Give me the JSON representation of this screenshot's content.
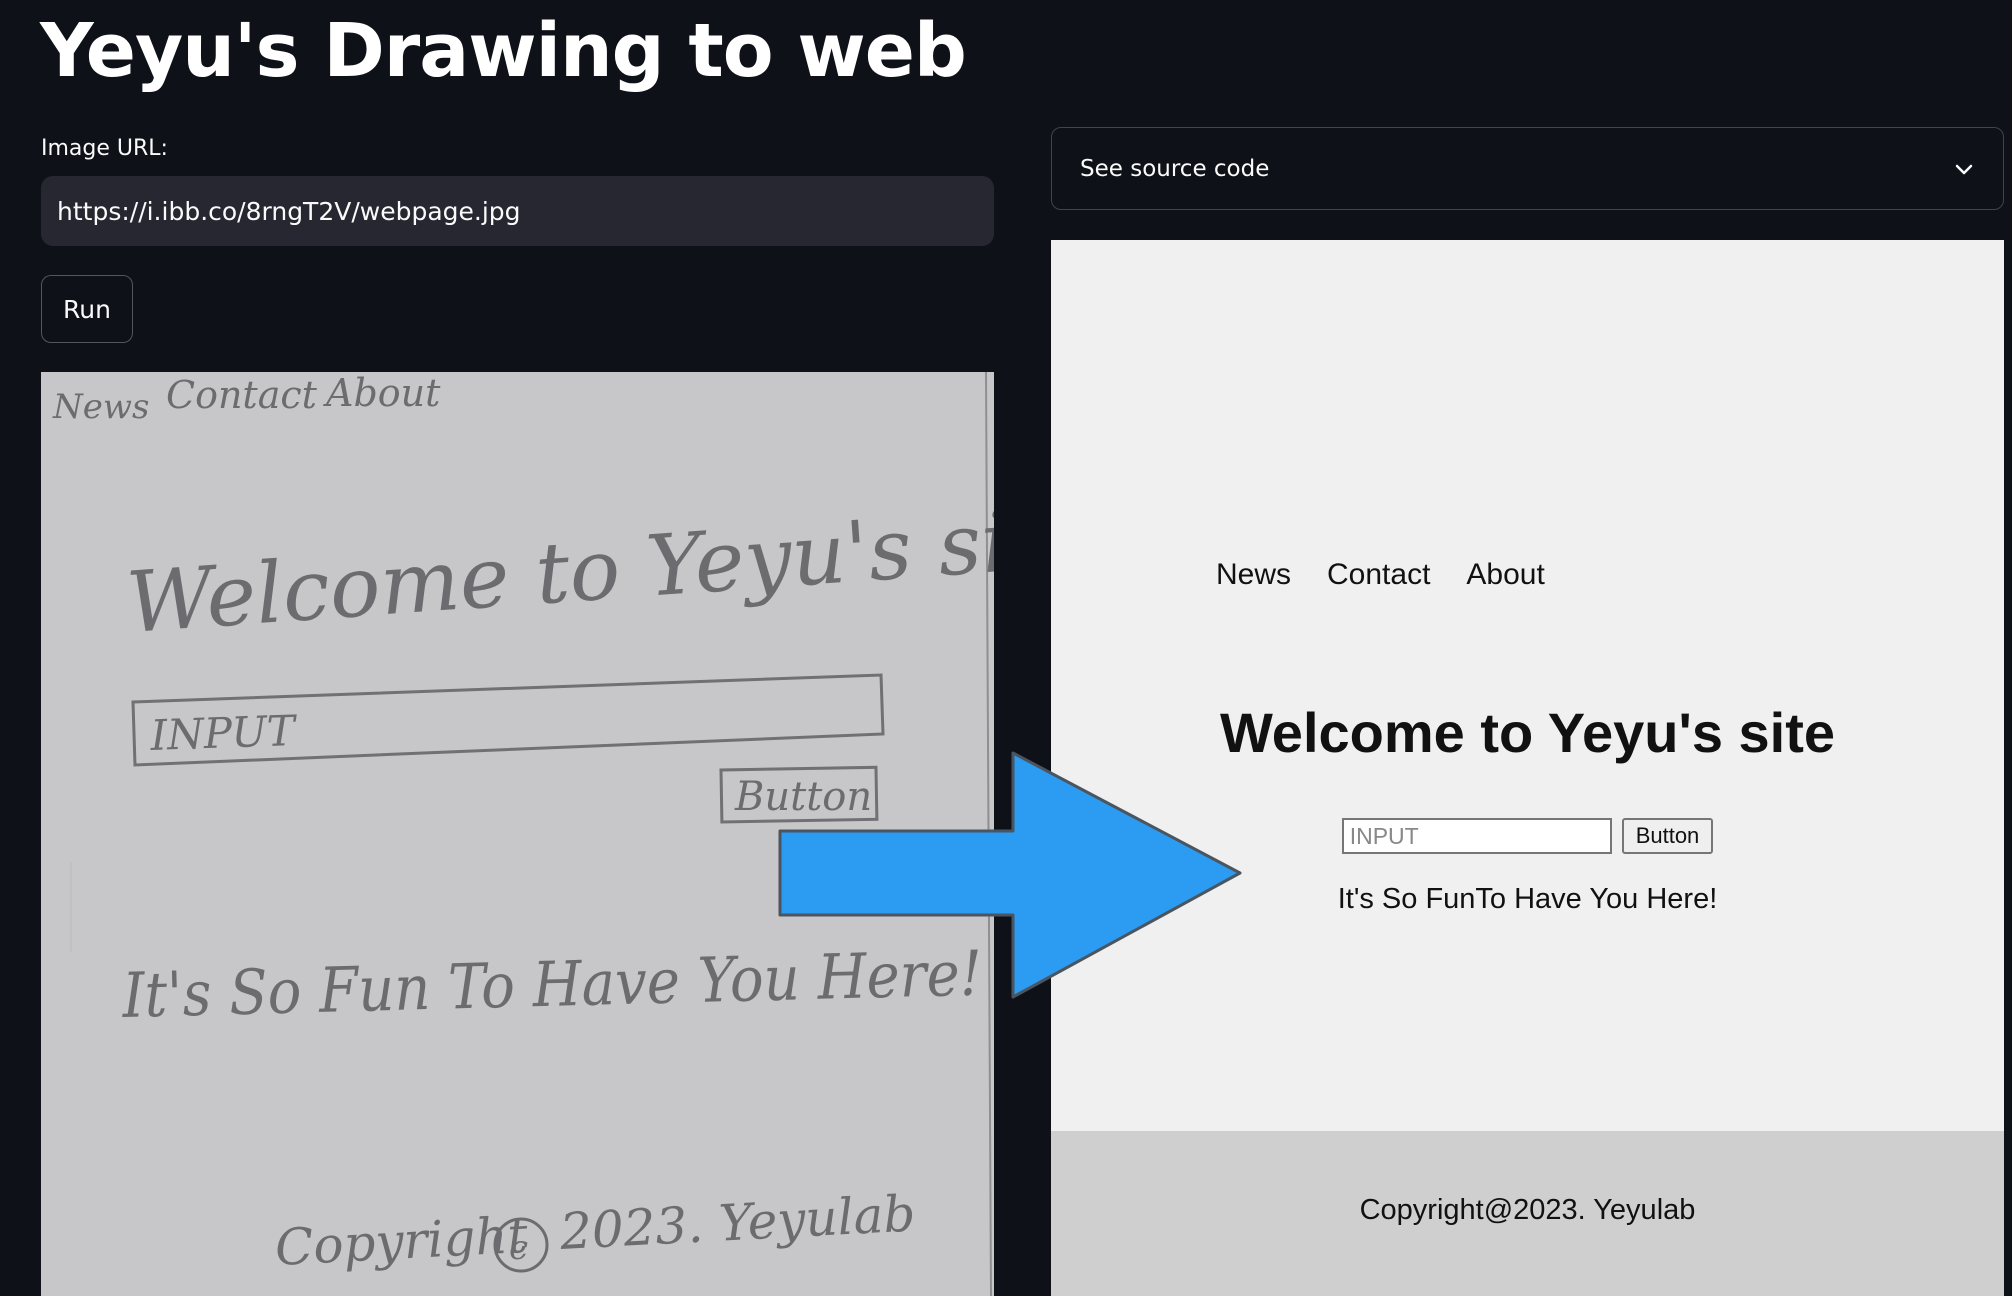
{
  "app": {
    "title": "Yeyu's Drawing to web"
  },
  "image_url": {
    "label": "Image URL:",
    "value": "https://i.ibb.co/8rngT2V/webpage.jpg"
  },
  "run_button": {
    "label": "Run"
  },
  "sketch": {
    "nav": [
      "News",
      "Contact",
      "About"
    ],
    "heading": "Welcome to Yeyu's site",
    "input": "INPUT",
    "button": "Button",
    "tagline": "It's So Fun To Have You Here!",
    "copyright_left": "Copyright",
    "copyright_symbol": "c",
    "copyright_right": "2023. Yeyulab"
  },
  "source_expander": {
    "label": "See source code",
    "icon": "chevron-down-icon"
  },
  "preview": {
    "nav": [
      "News",
      "Contact",
      "About"
    ],
    "heading": "Welcome to Yeyu's site",
    "input_placeholder": "INPUT",
    "button_label": "Button",
    "tagline": "It's So FunTo Have You Here!",
    "footer": "Copyright@2023. Yeyulab"
  },
  "colors": {
    "background": "#0e1117",
    "input_bg": "#262730",
    "arrow": "#2b9cf2",
    "preview_bg": "#f0f0f0",
    "footer_bg": "#cfcfcf"
  }
}
